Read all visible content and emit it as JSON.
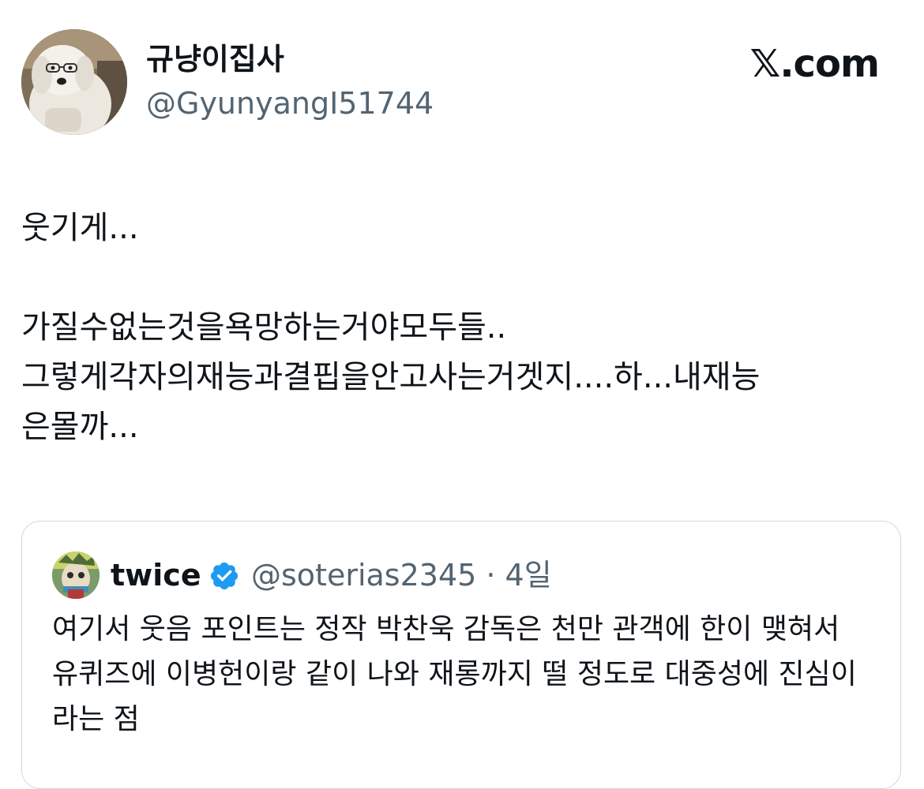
{
  "author": {
    "display_name": "규냥이집사",
    "handle": "@GyunyangI51744"
  },
  "brand": {
    "label": "𝕏.com"
  },
  "tweet": {
    "text": "웃기게...\n\n가질수없는것을욕망하는거야모두들..\n그렇게각자의재능과결핍을안고사는거겟지....하...내재능\n은몰까..."
  },
  "quote": {
    "display_name": "twice",
    "verified": true,
    "meta": "@soterias2345 · 4일",
    "text": "여기서 웃음 포인트는 정작 박찬욱 감독은 천만 관객에 한이 맺혀서 유퀴즈에 이병헌이랑 같이 나와 재롱까지 떨 정도로 대중성에 진심이라는 점"
  },
  "icons": {
    "verified": "verified-badge-icon",
    "verified_color": "#1d9bf0"
  }
}
